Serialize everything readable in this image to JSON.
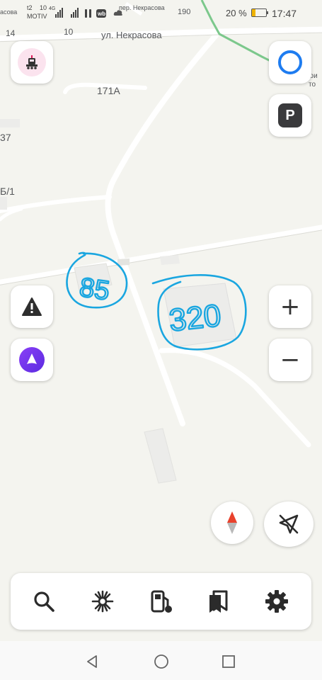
{
  "status_bar": {
    "carrier_1": "t2",
    "carrier_2": "MOTIV",
    "net_1": "10",
    "net_2": "4G",
    "battery": "20 %",
    "time": "17:47",
    "accent": "#f0b400"
  },
  "map": {
    "street_top": "пер. Некрасова",
    "street_main": "ул. Некрасова",
    "num_14": "14",
    "num_10": "10",
    "num_190": "190",
    "street_left_cut": "асова",
    "num_171a": "171А",
    "num_37": "37",
    "num_b1": "Б/1",
    "edge_top_right": "рои",
    "edge_top_right_2": "то",
    "handwritten_1": "85",
    "handwritten_2": "320",
    "ink_color": "#1aa6e0"
  },
  "controls": {
    "transport_icon": "train-icon",
    "layers_icon": "circle-icon",
    "parking_label": "P",
    "alert_icon": "warning-triangle-icon",
    "alice_icon": "alice-icon",
    "zoom_in": "+",
    "zoom_out": "−",
    "compass_icon": "compass-icon",
    "location_icon": "location-off-icon"
  },
  "bottom_bar": {
    "items": [
      "search-icon",
      "route-icon",
      "gas-station-icon",
      "bookmarks-icon",
      "settings-icon"
    ]
  },
  "nav_bar": {
    "items": [
      "back-icon",
      "home-icon",
      "recents-icon"
    ]
  }
}
